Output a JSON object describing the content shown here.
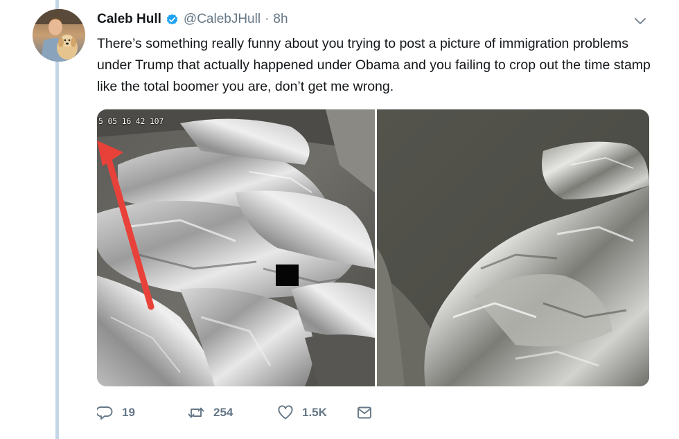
{
  "tweet": {
    "author_name": "Caleb Hull",
    "author_handle": "@CalebJHull",
    "separator": "·",
    "time_ago": "8h",
    "text": "There’s something really funny about you trying to post a picture of immigration problems under Trump that actually happened under Obama and you failing to crop out the time stamp like the total boomer you are, don’t get me wrong.",
    "media": {
      "overlay_timestamp": "5 05 16 42 107"
    },
    "actions": {
      "reply_count": "19",
      "retweet_count": "254",
      "like_count": "1.5K"
    }
  },
  "colors": {
    "verified_blue": "#1da1f2",
    "muted_text": "#657786",
    "thread_line": "#c4d6e6",
    "annotation_arrow": "#e8413a"
  },
  "icons": {
    "verified": "verified-badge-icon",
    "caret": "chevron-down-icon",
    "reply": "reply-icon",
    "retweet": "retweet-icon",
    "like": "heart-icon",
    "dm": "envelope-icon"
  }
}
